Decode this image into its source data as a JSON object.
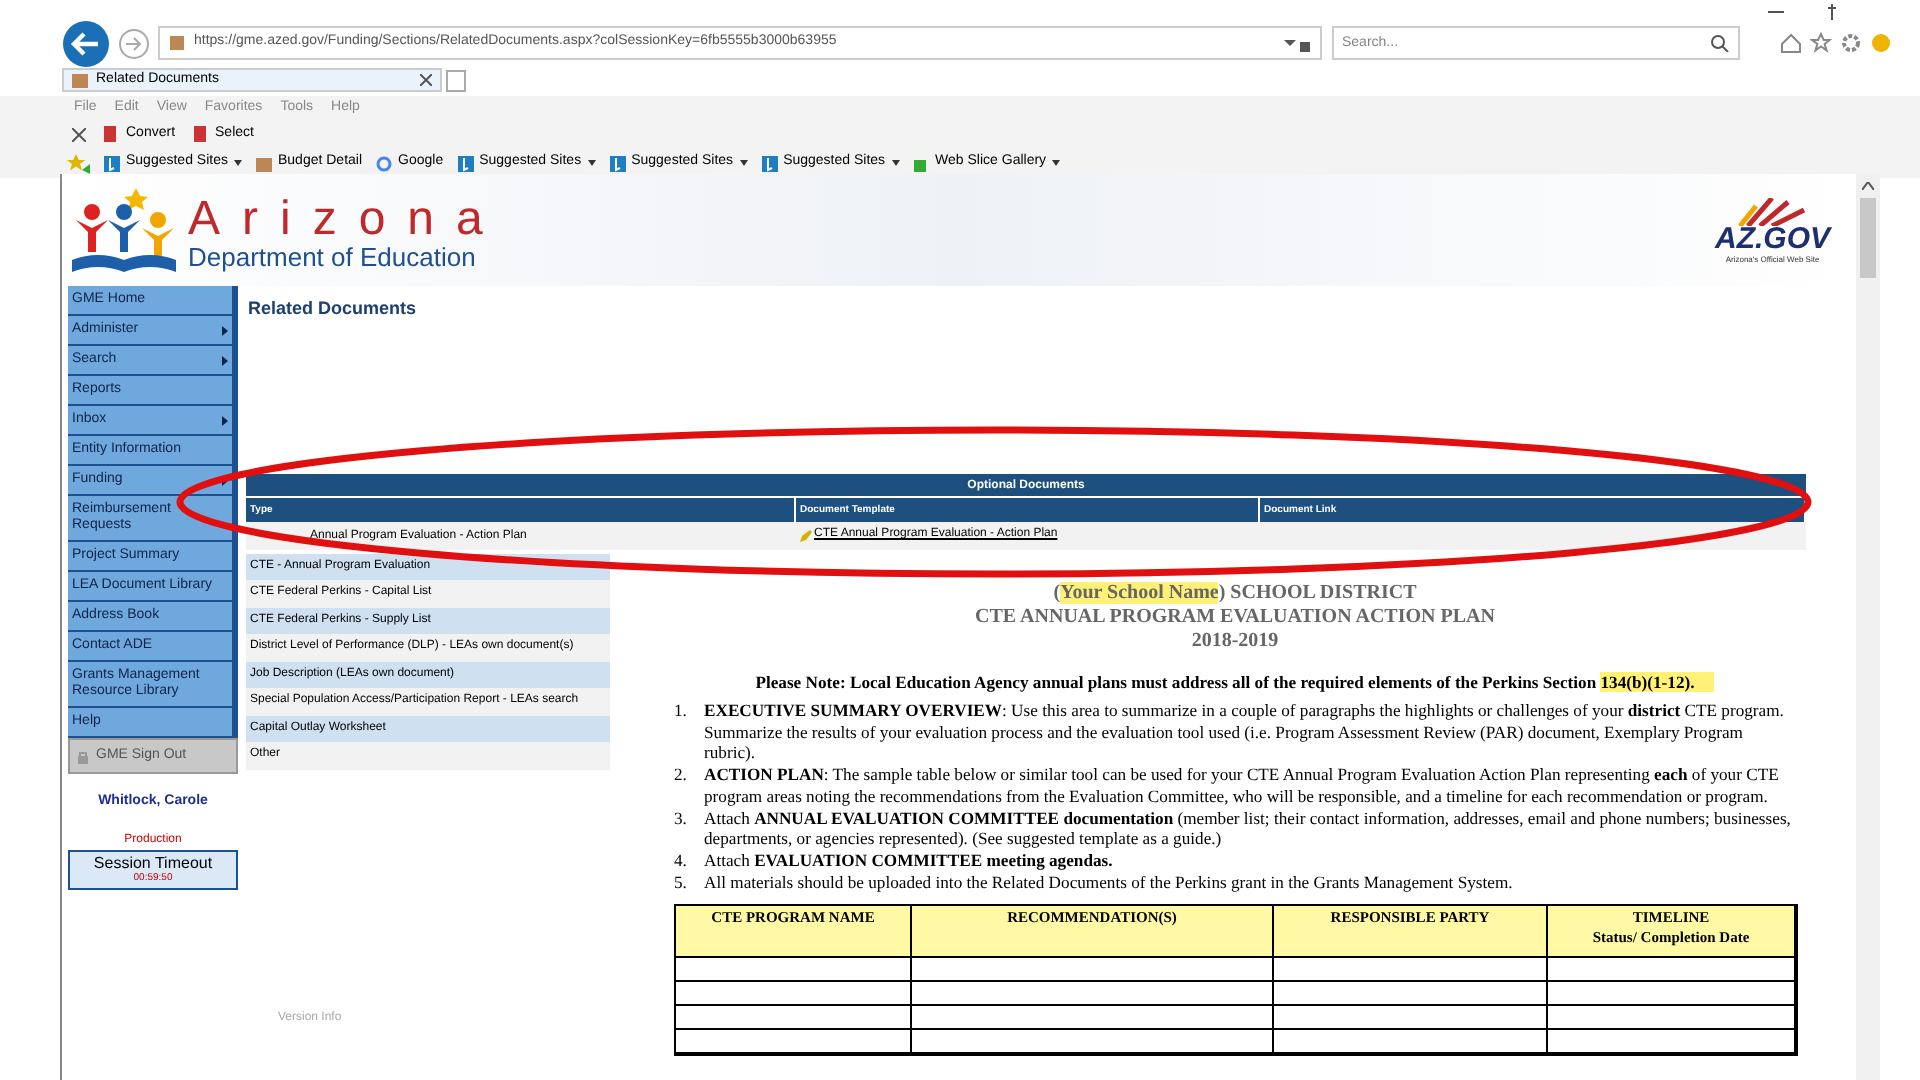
{
  "browser": {
    "url": "https://gme.azed.gov/Funding/Sections/RelatedDocuments.aspx?colSessionKey=6fb5555b3000b63955",
    "search": {
      "placeholder": "Search..."
    },
    "tab": {
      "title": "Related Documents"
    },
    "menu": [
      "File",
      "Edit",
      "View",
      "Favorites",
      "Tools",
      "Help"
    ],
    "toolbar": [
      "Convert",
      "Select"
    ],
    "favorites": [
      {
        "label": "Suggested Sites",
        "kind": "bing",
        "dropdown": true
      },
      {
        "label": "Budget Detail",
        "kind": "page",
        "dropdown": false
      },
      {
        "label": "Google",
        "kind": "google",
        "dropdown": false
      },
      {
        "label": "Suggested Sites",
        "kind": "bing",
        "dropdown": true
      },
      {
        "label": "Suggested Sites",
        "kind": "bing",
        "dropdown": true
      },
      {
        "label": "Suggested Sites",
        "kind": "bing",
        "dropdown": true
      },
      {
        "label": "Web Slice Gallery",
        "kind": "slice",
        "dropdown": true
      }
    ]
  },
  "header": {
    "logo_word": "Arizona",
    "logo_subtitle": "Department of Education",
    "gov_logo": "AZ.GOV",
    "gov_tagline": "Arizona's Official Web Site"
  },
  "nav": {
    "items": [
      {
        "label": "GME Home",
        "submenu": false
      },
      {
        "label": "Administer",
        "submenu": true
      },
      {
        "label": "Search",
        "submenu": true
      },
      {
        "label": "Reports",
        "submenu": false
      },
      {
        "label": "Inbox",
        "submenu": true
      },
      {
        "label": "Entity Information",
        "submenu": false
      },
      {
        "label": "Funding",
        "submenu": true
      },
      {
        "label": "Reimbursement Requests",
        "submenu": false
      },
      {
        "label": "Project Summary",
        "submenu": false
      },
      {
        "label": "LEA Document Library",
        "submenu": false
      },
      {
        "label": "Address Book",
        "submenu": false
      },
      {
        "label": "Contact ADE",
        "submenu": false
      },
      {
        "label": "Grants Management Resource Library",
        "submenu": false
      },
      {
        "label": "Help",
        "submenu": false
      }
    ],
    "sign_out": "GME Sign Out",
    "user": "Whitlock, Carole",
    "environment": "Production",
    "session_label": "Session Timeout",
    "session_time": "00:59:50",
    "version": "Version Info"
  },
  "page_title": "Related Documents",
  "optional_documents": {
    "title": "Optional Documents",
    "columns": [
      "Type",
      "Document Template",
      "Document Link"
    ],
    "rows": [
      {
        "type": "Annual Program Evaluation - Action Plan",
        "template": "CTE Annual Program Evaluation - Action Plan"
      }
    ]
  },
  "document_types": [
    "CTE - Annual Program Evaluation",
    "CTE Federal Perkins - Capital List",
    "CTE Federal Perkins - Supply List",
    "District Level of Performance (DLP) - LEAs own document(s)",
    "Job Description (LEAs own document)",
    "Special Population Access/Participation Report - LEAs search",
    "Capital Outlay Worksheet",
    "Other"
  ],
  "document": {
    "title_lines": [
      [
        {
          "text": "(",
          "highlight": false
        },
        {
          "text": "Your School Name",
          "highlight": true
        },
        {
          "text": ") SCHOOL DISTRICT",
          "highlight": false
        }
      ],
      [
        {
          "text": "CTE ANNUAL PROGRAM EVALUATION ACTION PLAN",
          "highlight": false
        }
      ],
      [
        {
          "text": "2018-2019",
          "highlight": false
        }
      ]
    ],
    "note": [
      {
        "text": "Please Note:  Local Education Agency annual plans must address all of the required elements of the Perkins Section ",
        "highlight": false
      },
      {
        "text": "134(b)(1-12).",
        "highlight": true
      }
    ],
    "items": [
      {
        "number": "1.",
        "text": "**EXECUTIVE SUMMARY OVERVIEW**:  Use this area to summarize in a couple of paragraphs the highlights or challenges of your **district** CTE program. Summarize the results of your evaluation process and the evaluation tool used (i.e. Program Assessment Review (PAR) document, Exemplary Program rubric)."
      },
      {
        "number": "2.",
        "text": "**ACTION PLAN**:  The sample table below or similar tool can be used for your CTE Annual Program Evaluation Action Plan representing **each** of your CTE program areas noting the recommendations from the Evaluation Committee, who will be responsible, and a timeline for each recommendation or program."
      },
      {
        "number": "3.",
        "text": "Attach **ANNUAL EVALUATION COMMITTEE documentation** (member list; their contact information, addresses, email and phone numbers; businesses, departments, or agencies represented).  (See suggested template as a guide.)"
      },
      {
        "number": "4.",
        "text": "Attach **EVALUATION COMMITTEE meeting agendas.**"
      },
      {
        "number": "5.",
        "text": "All materials should be uploaded into the Related Documents of the Perkins grant in the Grants Management System."
      }
    ],
    "plan_table": {
      "columns": [
        [
          "CTE PROGRAM NAME"
        ],
        [
          "RECOMMENDATION(S)"
        ],
        [
          "RESPONSIBLE PARTY"
        ],
        [
          "TIMELINE",
          "Status/ Completion Date"
        ]
      ]
    }
  }
}
